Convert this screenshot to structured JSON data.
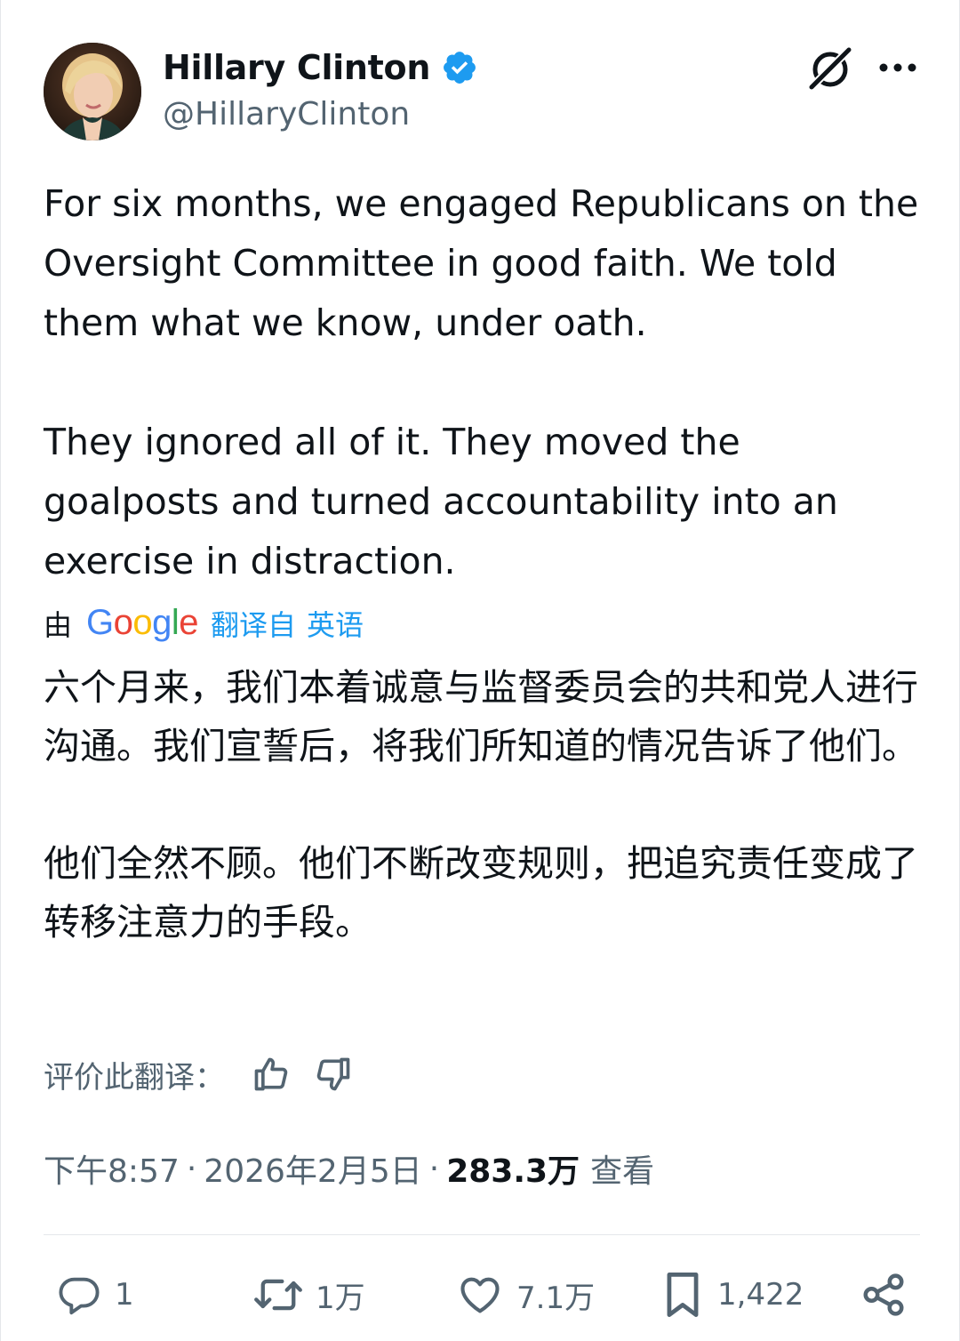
{
  "author": {
    "display_name": "Hillary Clinton",
    "handle": "@HillaryClinton",
    "verified_icon": "verified-badge-icon",
    "verified_color": "#1d9bf0"
  },
  "header_actions": {
    "grok_icon": "grok-icon",
    "more_icon": "more-options-icon"
  },
  "tweet": {
    "paragraphs": [
      "For six months, we engaged Republicans on the Oversight Committee in good faith. We told them what we know, under oath.",
      "They ignored all of it. They moved the goalposts and turned accountability into an exercise in distraction."
    ]
  },
  "translation": {
    "prefix": "由",
    "provider": [
      "G",
      "o",
      "o",
      "g",
      "l",
      "e"
    ],
    "provider_colors": [
      "#4285f4",
      "#ea4335",
      "#fbbc05",
      "#4285f4",
      "#34a853",
      "#ea4335"
    ],
    "translated_from": "翻译自",
    "language": "英语",
    "paragraphs": [
      "六个月来，我们本着诚意与监督委员会的共和党人进行沟通。我们宣誓后，将我们所知道的情况告诉了他们。",
      "他们全然不顾。他们不断改变规则，把追究责任变成了转移注意力的手段。"
    ],
    "rate_label": "评价此翻译：",
    "thumbs_up_icon": "thumbs-up-icon",
    "thumbs_down_icon": "thumbs-down-icon"
  },
  "meta": {
    "time": "下午8:57",
    "separator": "·",
    "date": "2026年2月5日",
    "views_count": "283.3万",
    "views_label": "查看"
  },
  "actions": {
    "replies": "1",
    "reposts": "1万",
    "likes": "7.1万",
    "bookmarks": "1,422",
    "icons": [
      "reply-icon",
      "repost-icon",
      "like-icon",
      "bookmark-icon",
      "share-icon"
    ]
  },
  "colors": {
    "text": "#0f1419",
    "secondary": "#536471",
    "link": "#1d9bf0",
    "divider": "#e4e7ea"
  }
}
